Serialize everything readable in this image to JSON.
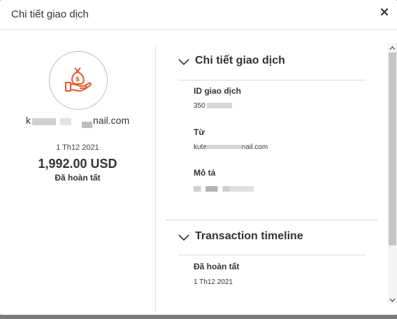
{
  "modal": {
    "title": "Chi tiết giao dịch",
    "close_icon": "close-icon"
  },
  "summary": {
    "icon": "money-bag-hand-icon",
    "email_prefix": "k",
    "email_suffix": "nail.com",
    "date": "1 Th12 2021",
    "amount": "1,992.00 USD",
    "status": "Đã hoàn tất",
    "accent_color": "#e8592c"
  },
  "details": {
    "heading": "Chi tiết giao dịch",
    "transaction_id_label": "ID giao dịch",
    "transaction_id_value": "350",
    "from_label": "Từ",
    "from_value_prefix": "kute",
    "from_value_suffix": "nail.com",
    "description_label": "Mô tả"
  },
  "timeline": {
    "heading": "Transaction timeline",
    "status": "Đã hoàn tất",
    "date": "1 Th12 2021"
  }
}
